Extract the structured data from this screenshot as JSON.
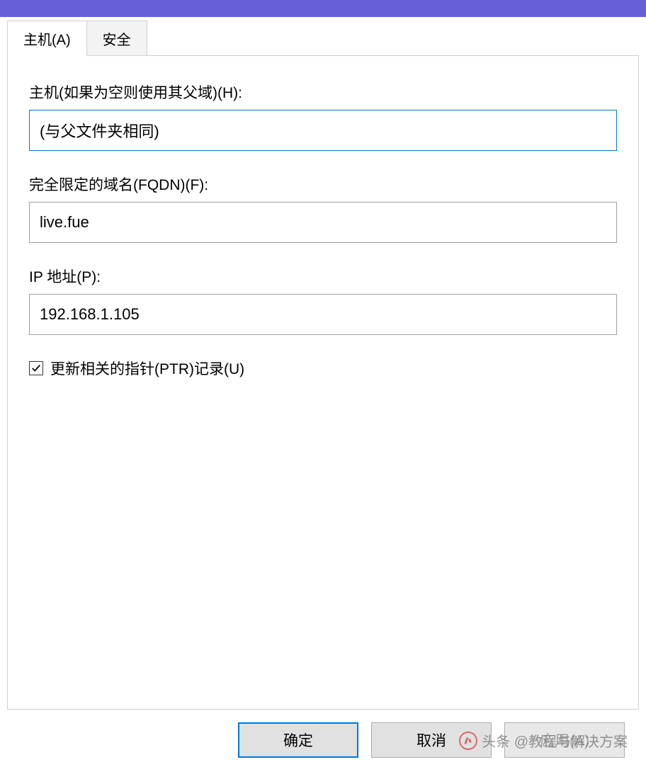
{
  "tabs": {
    "host": "主机(A)",
    "security": "安全"
  },
  "fields": {
    "host_label": "主机(如果为空则使用其父域)(H):",
    "host_value": "(与父文件夹相同)",
    "fqdn_label": "完全限定的域名(FQDN)(F):",
    "fqdn_value": "live.fue",
    "ip_label": "IP 地址(P):",
    "ip_value": "192.168.1.105"
  },
  "checkbox": {
    "ptr_label": "更新相关的指针(PTR)记录(U)",
    "ptr_checked": true
  },
  "buttons": {
    "ok": "确定",
    "cancel": "取消",
    "apply": "应用(A)"
  },
  "watermark": {
    "text": "头条 @教程与解决方案"
  }
}
